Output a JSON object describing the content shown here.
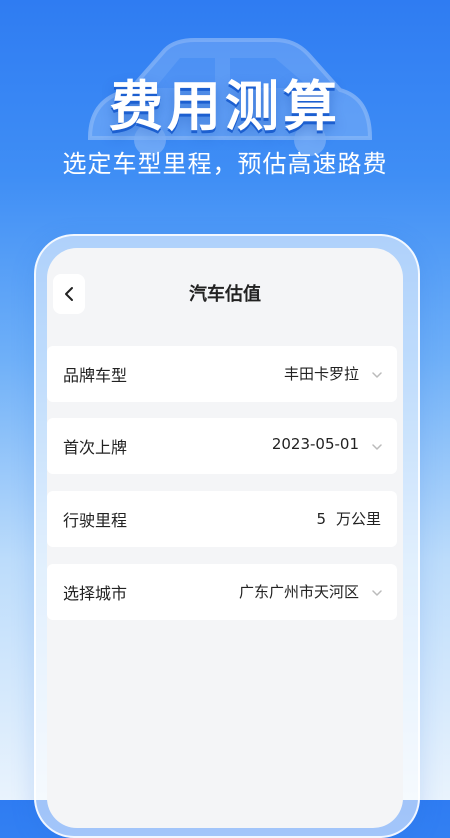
{
  "hero": {
    "title": "费用测算",
    "subtitle": "选定车型里程，预估高速路费"
  },
  "nav": {
    "title": "汽车估值"
  },
  "form": {
    "brand_model": {
      "label": "品牌车型",
      "value": "丰田卡罗拉"
    },
    "first_registration": {
      "label": "首次上牌",
      "value": "2023-05-01"
    },
    "mileage": {
      "label": "行驶里程",
      "value": "5",
      "unit": "万公里"
    },
    "city": {
      "label": "选择城市",
      "value": "广东广州市天河区"
    }
  },
  "icons": {
    "back": "chevron-left-icon",
    "dropdown": "chevron-down-icon",
    "background": "car-silhouette-icon"
  },
  "colors": {
    "accent": "#2f7cf2",
    "text": "#222222",
    "muted": "#bbbbbb"
  }
}
